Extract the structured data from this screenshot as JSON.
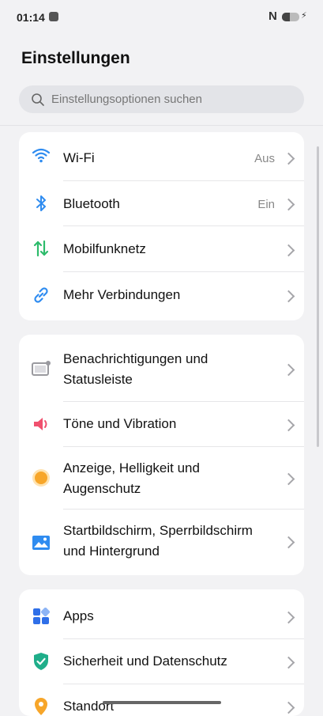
{
  "status_bar": {
    "time": "01:14",
    "nfc": "N",
    "battery_level": 0.45
  },
  "header": {
    "title": "Einstellungen"
  },
  "search": {
    "placeholder": "Einstellungsoptionen suchen"
  },
  "groups": [
    {
      "items": [
        {
          "label": "Wi-Fi",
          "value": "Aus",
          "icon": "wifi-icon",
          "color": "#2f8cf0"
        },
        {
          "label": "Bluetooth",
          "value": "Ein",
          "icon": "bluetooth-icon",
          "color": "#2f8cf0"
        },
        {
          "label": "Mobilfunknetz",
          "icon": "mobile-data-icon",
          "color": "#2dbb6b"
        },
        {
          "label": "Mehr Verbindungen",
          "icon": "link-icon",
          "color": "#2f8cf0"
        }
      ]
    },
    {
      "items": [
        {
          "label1": "Benachrichtigungen und",
          "label2": "Statusleiste",
          "icon": "notification-icon",
          "color": "#9a9a9f"
        },
        {
          "label": "Töne und Vibration",
          "icon": "speaker-icon",
          "color": "#f0506e"
        },
        {
          "label1": "Anzeige, Helligkeit und",
          "label2": "Augenschutz",
          "icon": "brightness-icon",
          "color": "#f7a62a"
        },
        {
          "label1": "Startbildschirm, Sperrbildschirm",
          "label2": "und Hintergrund",
          "icon": "wallpaper-icon",
          "color": "#2f8cf0"
        }
      ]
    },
    {
      "items": [
        {
          "label": "Apps",
          "icon": "apps-icon",
          "color": "#2f6fe8"
        },
        {
          "label": "Sicherheit und Datenschutz",
          "icon": "shield-icon",
          "color": "#1fae8a"
        },
        {
          "label": "Standort",
          "icon": "location-icon",
          "color": "#f7a62a"
        }
      ]
    }
  ]
}
